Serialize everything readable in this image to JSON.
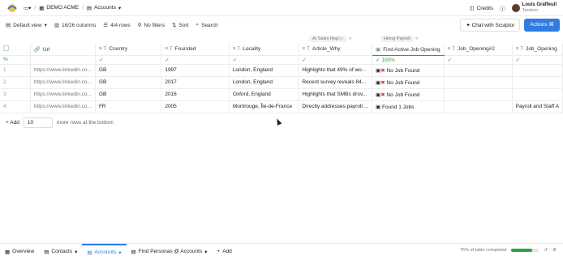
{
  "topbar": {
    "workspace": "DEMO ACME",
    "table": "Accounts",
    "credits": "Credits",
    "user_name": "Louis Graffeuil",
    "user_org": "Tandem"
  },
  "toolbar": {
    "view": "Default view",
    "columns": "16/26 columns",
    "rows": "4/4 rows",
    "filters": "No filters",
    "sort": "Sort",
    "search": "Search",
    "chat": "Chat with Sculptor",
    "actions": "Actions"
  },
  "groups": {
    "ai_sales": "AI Sales Rep",
    "hiring": "Hiring Payroll"
  },
  "columns": [
    "Url",
    "Country",
    "Founded",
    "Locality",
    "Article_Why",
    "Find Active Job Opening",
    "Job_Opening#2",
    "Job_Opening"
  ],
  "sub_row": {
    "label": "%",
    "pct": "100%"
  },
  "rows": [
    {
      "n": "1",
      "url": "https://www.linkedin.co...",
      "country": "GB",
      "founded": "1997",
      "locality": "London, England",
      "why": "Highlights that 49% of wo...",
      "job": "No Job Found",
      "job2": "",
      "job3": ""
    },
    {
      "n": "2",
      "url": "https://www.linkedin.co...",
      "country": "GB",
      "founded": "2017",
      "locality": "London, England",
      "why": "Recent survey reveals 84...",
      "job": "No Job Found",
      "job2": "",
      "job3": ""
    },
    {
      "n": "3",
      "url": "https://www.linkedin.co...",
      "country": "GB",
      "founded": "2016",
      "locality": "Oxford, England",
      "why": "Highlights that SMBs drov...",
      "job": "No Job Found",
      "job2": "",
      "job3": ""
    },
    {
      "n": "4",
      "url": "https://www.linkedin.co...",
      "country": "FR",
      "founded": "2005",
      "locality": "Montrouge, Île-de-France",
      "why": "Directly addresses payroll ...",
      "job": "Found 1 Jobs",
      "job2": "",
      "job3": "Payroll and Staff A"
    }
  ],
  "add_rows": {
    "label": "Add",
    "count": "10",
    "suffix": "more rows at the bottom"
  },
  "bottombar": {
    "tabs": [
      "Overview",
      "Contacts",
      "Accounts",
      "Find Personas @ Accounts",
      "Add"
    ],
    "completed_label": "75% of table completed",
    "completed_value": 0.75
  },
  "colors": {
    "accent": "#2f7de1",
    "success": "#2ea043",
    "error": "#d33333"
  }
}
